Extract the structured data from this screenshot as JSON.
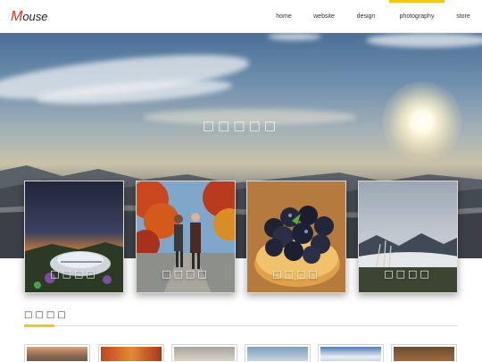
{
  "brand": {
    "initial": "M",
    "rest": "ouse",
    "accent_color": "#e0301e"
  },
  "nav": {
    "items": [
      {
        "label": "home"
      },
      {
        "label": "website"
      },
      {
        "label": "design"
      },
      {
        "label": "photography",
        "active": true
      },
      {
        "label": "store"
      }
    ],
    "active_color": "#f5c518"
  },
  "hero": {
    "title": "□□□□□"
  },
  "cards": [
    {
      "label": "□□□□"
    },
    {
      "label": "□□□□"
    },
    {
      "label": "□□□□"
    },
    {
      "label": "□□□□"
    }
  ],
  "section": {
    "title": "□□□□"
  },
  "thumbnails_count_visible": 6
}
